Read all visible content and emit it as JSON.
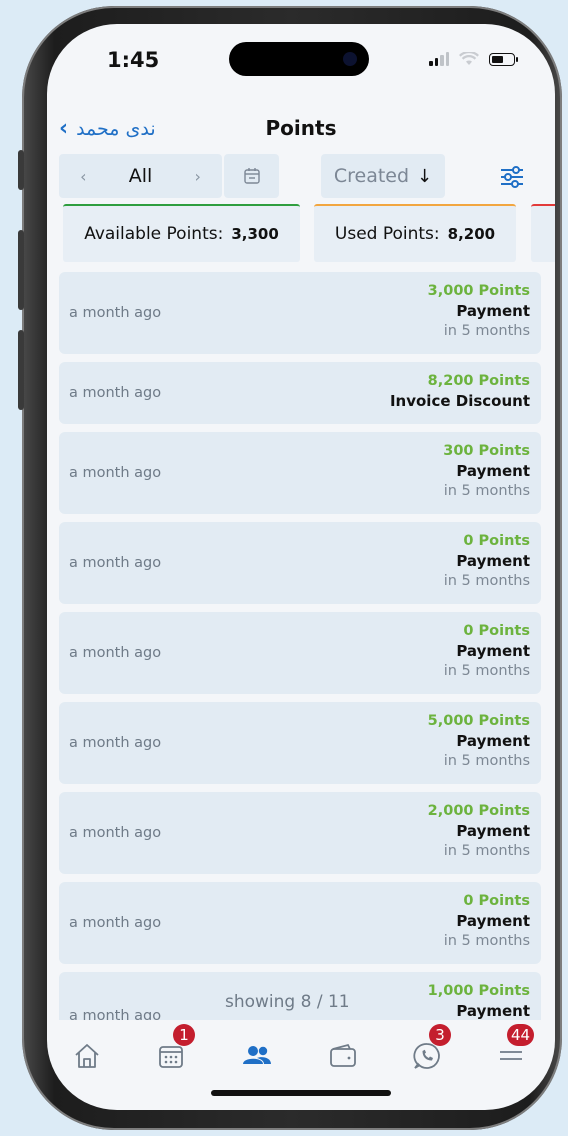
{
  "status": {
    "time": "1:45"
  },
  "header": {
    "back_label": "ندى محمد",
    "title": "Points"
  },
  "filters": {
    "period_label": "All",
    "sort_label": "Created"
  },
  "summary": {
    "available_label": "Available Points:",
    "available_value": "3,300",
    "used_label": "Used Points:",
    "used_value": "8,200"
  },
  "transactions": [
    {
      "when": "a month ago",
      "points": "3,000 Points",
      "type": "Payment",
      "expires": "in 5 months"
    },
    {
      "when": "a month ago",
      "points": "8,200 Points",
      "type": "Invoice Discount",
      "expires": ""
    },
    {
      "when": "a month ago",
      "points": "300 Points",
      "type": "Payment",
      "expires": "in 5 months"
    },
    {
      "when": "a month ago",
      "points": "0 Points",
      "type": "Payment",
      "expires": "in 5 months"
    },
    {
      "when": "a month ago",
      "points": "0 Points",
      "type": "Payment",
      "expires": "in 5 months"
    },
    {
      "when": "a month ago",
      "points": "5,000 Points",
      "type": "Payment",
      "expires": "in 5 months"
    },
    {
      "when": "a month ago",
      "points": "2,000 Points",
      "type": "Payment",
      "expires": "in 5 months"
    },
    {
      "when": "a month ago",
      "points": "0 Points",
      "type": "Payment",
      "expires": "in 5 months"
    },
    {
      "when": "a month ago",
      "points": "1,000 Points",
      "type": "Payment",
      "expires": ""
    }
  ],
  "pagination": {
    "showing": "showing 8 / 11"
  },
  "tabbar": {
    "items": [
      {
        "icon": "home-icon"
      },
      {
        "icon": "calendar-icon",
        "badge": "1"
      },
      {
        "icon": "users-icon"
      },
      {
        "icon": "wallet-icon"
      },
      {
        "icon": "whatsapp-icon",
        "badge": "3"
      },
      {
        "icon": "menu-icon",
        "badge": "44"
      }
    ],
    "active_color": "#1f6fc6",
    "badge_color": "#c41e2e"
  },
  "colors": {
    "points_green": "#6cb33e",
    "accent_blue": "#1f6fc6",
    "available_border": "#2f9e3f",
    "used_border": "#f2a640"
  }
}
